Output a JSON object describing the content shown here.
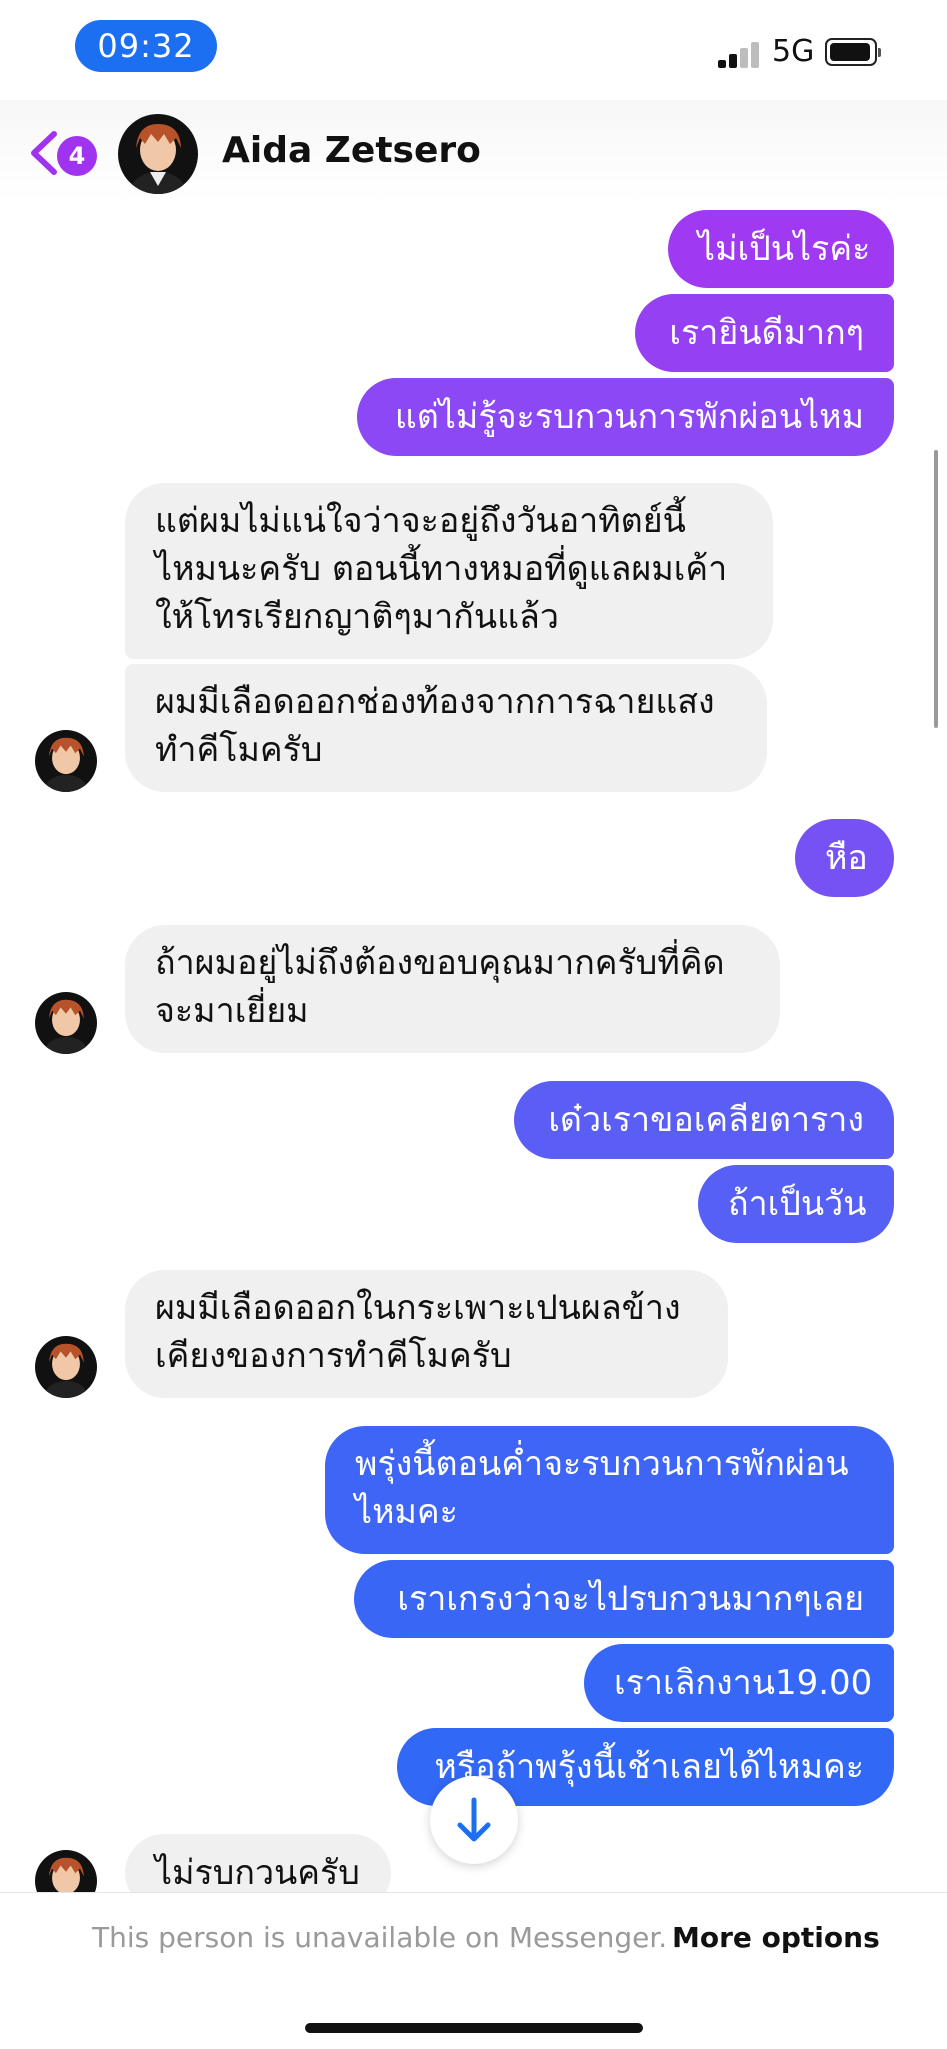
{
  "status_bar": {
    "time": "09:32",
    "network": "5G",
    "icons": [
      "signal-bars-icon",
      "battery-icon"
    ]
  },
  "header": {
    "back_icon": "chevron-left-icon",
    "unread_count": "4",
    "contact_name": "Aida Zetsero"
  },
  "colors": {
    "sent_gradient_top": "#a23af2",
    "sent_gradient_bottom": "#2f63f6",
    "received_bg": "#f0f0f0",
    "accent_blue": "#1d6ff2",
    "badge_purple": "#a033f0"
  },
  "messages": [
    {
      "from": "me",
      "text": "ไม่เป็นไรค่ะ"
    },
    {
      "from": "me",
      "text": "เรายินดีมากๆ"
    },
    {
      "from": "me",
      "text": "แต่ไม่รู้จะรบกวนการพักผ่อนไหม"
    },
    {
      "from": "them",
      "text": "แต่ผมไม่แน่ใจว่าจะอยู่ถึงวันอาทิตย์นี้\nไหมนะครับ ตอนนี้ทางหมอที่ดูแลผมเค้า\nให้โทรเรียกญาติๆมากันแล้ว"
    },
    {
      "from": "them",
      "text": "ผมมีเลือดออกช่องท้องจากการฉายแสง\nทำคีโมครับ"
    },
    {
      "from": "me",
      "text": "หือ"
    },
    {
      "from": "them",
      "text": "ถ้าผมอยู่ไม่ถึงต้องขอบคุณมากครับที่คิด\nจะมาเยี่ยม"
    },
    {
      "from": "me",
      "text": "เด๋วเราขอเคลียตาราง"
    },
    {
      "from": "me",
      "text": "ถ้าเป็นวัน"
    },
    {
      "from": "them",
      "text": "ผมมีเลือดออกในกระเพาะเปนผลข้าง\nเคียงของการทำคีโมครับ"
    },
    {
      "from": "me",
      "text": "พรุ่งนี้ตอนค่ำจะรบกวนการพักผ่อน\nไหมคะ"
    },
    {
      "from": "me",
      "text": "เราเกรงว่าจะไปรบกวนมากๆเลย"
    },
    {
      "from": "me",
      "text": "เราเลิกงาน19.00"
    },
    {
      "from": "me",
      "text": "หรือถ้าพรุ้งนี้เช้าเลยได้ไหมคะ"
    },
    {
      "from": "them",
      "text": "ไม่รบกวนครับ"
    }
  ],
  "footer": {
    "unavailable_text": "This person is unavailable on Messenger.",
    "more_options_label": "More options"
  },
  "scroll_down_icon": "arrow-down-icon"
}
